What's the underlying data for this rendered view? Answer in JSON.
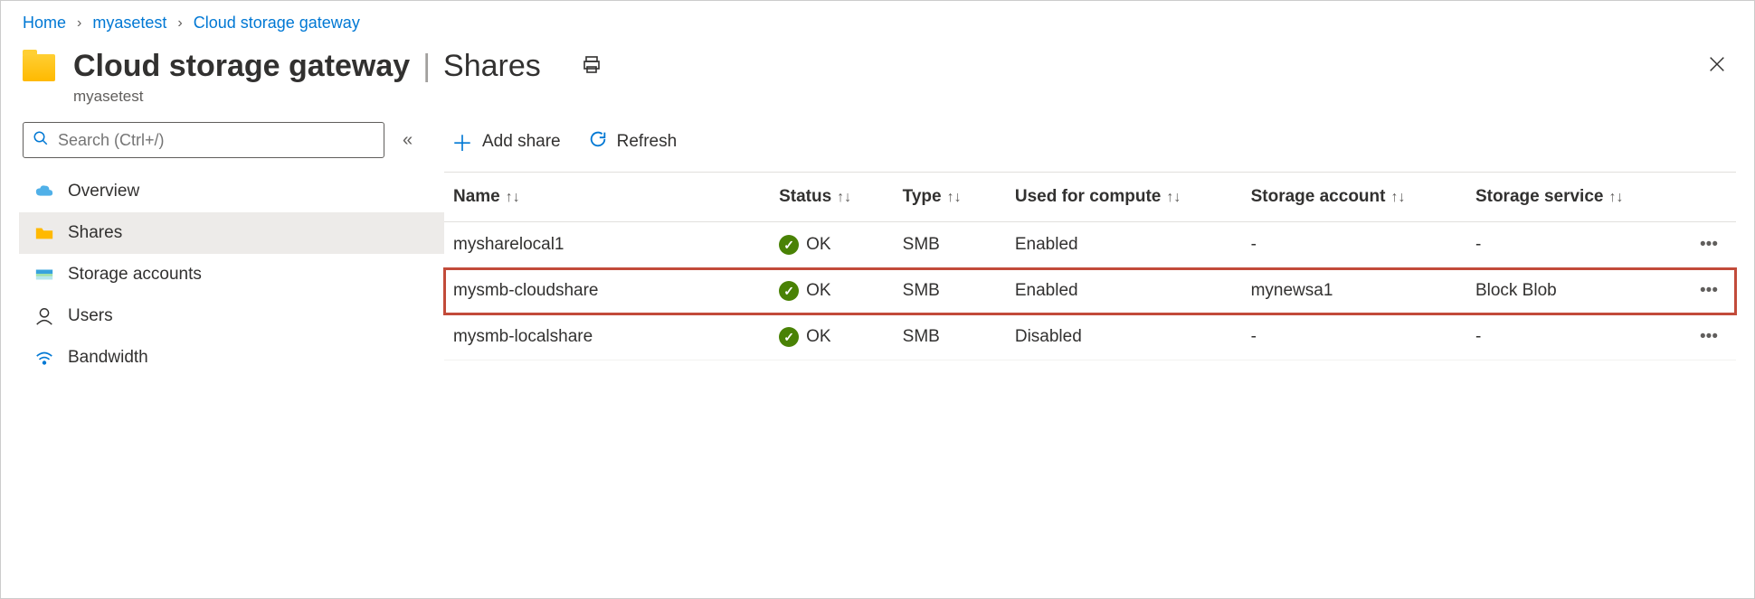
{
  "breadcrumb": {
    "home": "Home",
    "resource": "myasetest",
    "blade": "Cloud storage gateway"
  },
  "header": {
    "title": "Cloud storage gateway",
    "section": "Shares",
    "subtitle": "myasetest"
  },
  "search": {
    "placeholder": "Search (Ctrl+/)"
  },
  "sidebar": {
    "items": [
      {
        "label": "Overview"
      },
      {
        "label": "Shares"
      },
      {
        "label": "Storage accounts"
      },
      {
        "label": "Users"
      },
      {
        "label": "Bandwidth"
      }
    ]
  },
  "toolbar": {
    "add": "Add share",
    "refresh": "Refresh"
  },
  "table": {
    "columns": {
      "name": "Name",
      "status": "Status",
      "type": "Type",
      "compute": "Used for compute",
      "account": "Storage account",
      "service": "Storage service"
    },
    "rows": [
      {
        "name": "mysharelocal1",
        "status": "OK",
        "type": "SMB",
        "compute": "Enabled",
        "account": "-",
        "service": "-"
      },
      {
        "name": "mysmb-cloudshare",
        "status": "OK",
        "type": "SMB",
        "compute": "Enabled",
        "account": "mynewsa1",
        "service": "Block Blob"
      },
      {
        "name": "mysmb-localshare",
        "status": "OK",
        "type": "SMB",
        "compute": "Disabled",
        "account": "-",
        "service": "-"
      }
    ]
  }
}
